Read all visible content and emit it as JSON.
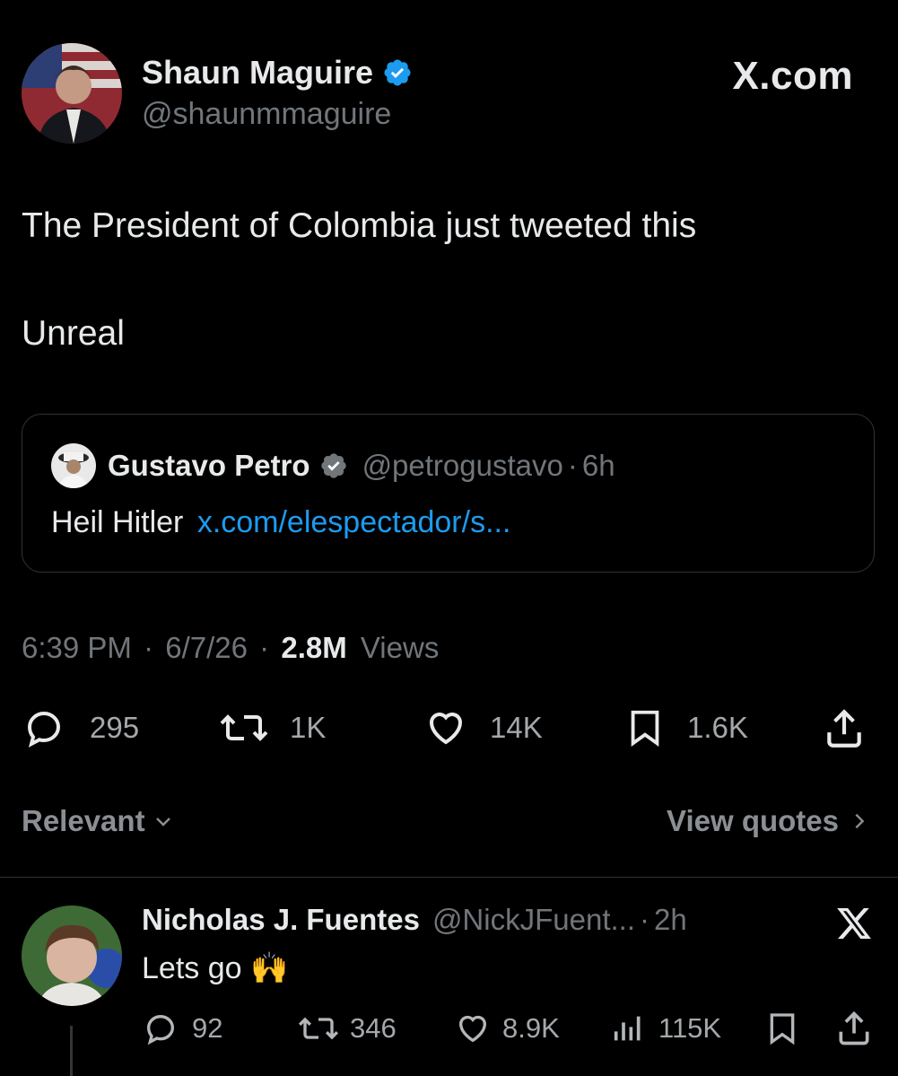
{
  "main_tweet": {
    "author_name": "Shaun Maguire",
    "author_handle": "@shaunmmaguire",
    "brand": "X.com",
    "text_line1": "The President of Colombia just tweeted this",
    "text_line2": "Unreal",
    "quote": {
      "author_name": "Gustavo Petro",
      "author_handle": "@petrogustavo",
      "separator": "·",
      "age": "6h",
      "text": "Heil Hitler",
      "link": "x.com/elespectador/s..."
    },
    "meta": {
      "time": "6:39 PM",
      "date": "6/7/26",
      "views_count": "2.8M",
      "views_label": "Views",
      "separator": "·"
    },
    "actions": {
      "replies": "295",
      "reposts": "1K",
      "likes": "14K",
      "bookmarks": "1.6K"
    }
  },
  "filters": {
    "sort_label": "Relevant",
    "view_quotes_label": "View quotes"
  },
  "reply": {
    "author_name": "Nicholas J. Fuentes",
    "author_handle": "@NickJFuent...",
    "separator": "·",
    "age": "2h",
    "text": "Lets go 🙌",
    "actions": {
      "replies": "92",
      "reposts": "346",
      "likes": "8.9K",
      "views": "115K"
    }
  },
  "colors": {
    "background": "#000000",
    "text": "#e7e9ea",
    "muted": "#71767b",
    "link": "#1d9bf0",
    "verified": "#1d9bf0",
    "border": "#2f3336"
  },
  "icons": [
    "verified-badge-icon",
    "x-logo-icon",
    "reply-icon",
    "repost-icon",
    "like-icon",
    "bookmark-icon",
    "share-icon",
    "views-icon",
    "chevron-down-icon",
    "chevron-right-icon"
  ]
}
